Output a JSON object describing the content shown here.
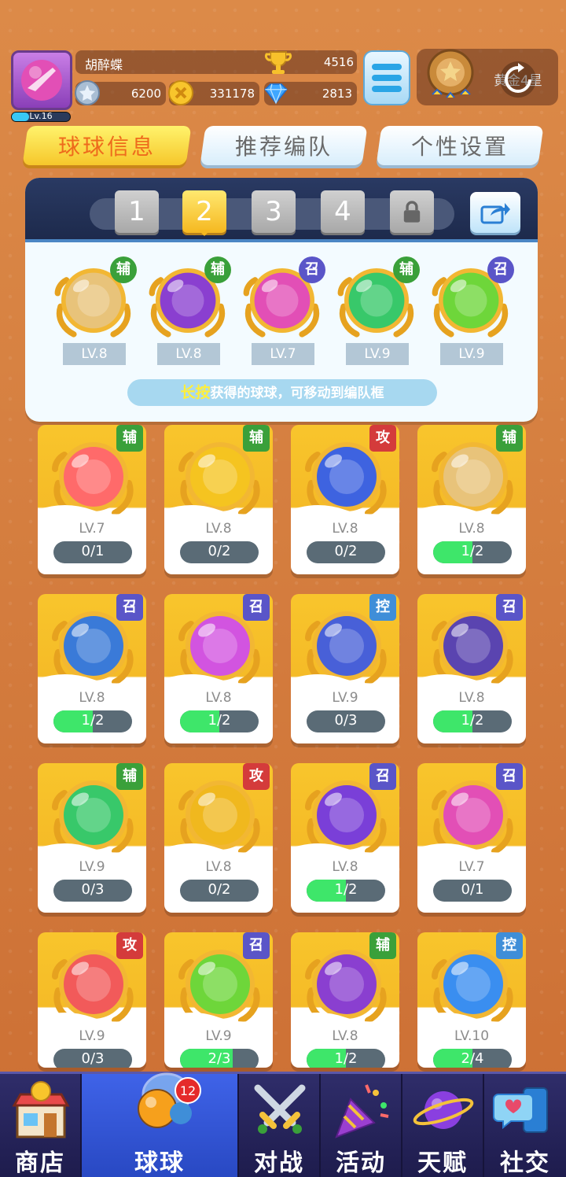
{
  "player": {
    "name": "胡醉蝶",
    "level": "Lv.16",
    "trophies": "4516",
    "silver": "6200",
    "gold": "331178",
    "gems": "2813",
    "rank": "黄金4星"
  },
  "tabs": [
    "球球信息",
    "推荐编队",
    "个性设置"
  ],
  "team": {
    "slots": [
      "1",
      "2",
      "3",
      "4"
    ],
    "active_slot": "2",
    "hint_key": "长按",
    "hint_rest": "获得的球球，可移动到编队框",
    "balls": [
      {
        "badge": "辅",
        "level": "LV.8",
        "icon": "people-ball-icon",
        "color": "#e8c37a"
      },
      {
        "badge": "辅",
        "level": "LV.8",
        "icon": "leaf-swirl-ball-icon",
        "color": "#8a3fd0"
      },
      {
        "badge": "召",
        "level": "LV.7",
        "icon": "knife-ball-icon",
        "color": "#e24fb6"
      },
      {
        "badge": "辅",
        "level": "LV.9",
        "icon": "star-arrow-ball-icon",
        "color": "#38c86a"
      },
      {
        "badge": "召",
        "level": "LV.9",
        "icon": "star-circle-ball-icon",
        "color": "#6ed63a"
      }
    ]
  },
  "cards": [
    {
      "badge": "辅",
      "type": "fu",
      "level": "LV.7",
      "progress": "0/1",
      "fill": 0,
      "icon": "gift-ball-icon",
      "color": "#ff6a6a"
    },
    {
      "badge": "辅",
      "type": "fu",
      "level": "LV.8",
      "progress": "0/2",
      "fill": 0,
      "icon": "piggy-bank-ball-icon",
      "color": "#f5c420"
    },
    {
      "badge": "攻",
      "type": "gong",
      "level": "LV.8",
      "progress": "0/2",
      "fill": 0,
      "icon": "vortex-ball-icon",
      "color": "#3e63e0"
    },
    {
      "badge": "辅",
      "type": "fu",
      "level": "LV.8",
      "progress": "1/2",
      "fill": 0.5,
      "icon": "people-ball-icon",
      "color": "#e8c37a"
    },
    {
      "badge": "召",
      "type": "zhao",
      "level": "LV.8",
      "progress": "1/2",
      "fill": 0.5,
      "icon": "whirlwind-ball-icon",
      "color": "#3a7ad8"
    },
    {
      "badge": "召",
      "type": "zhao",
      "level": "LV.8",
      "progress": "1/2",
      "fill": 0.5,
      "icon": "mushroom-cloud-ball-icon",
      "color": "#d254e0"
    },
    {
      "badge": "控",
      "type": "kong",
      "level": "LV.9",
      "progress": "0/3",
      "fill": 0,
      "icon": "clock-ball-icon",
      "color": "#4860d8"
    },
    {
      "badge": "召",
      "type": "zhao",
      "level": "LV.8",
      "progress": "1/2",
      "fill": 0.5,
      "icon": "ghost-ball-icon",
      "color": "#5a44b0"
    },
    {
      "badge": "辅",
      "type": "fu",
      "level": "LV.9",
      "progress": "0/3",
      "fill": 0,
      "icon": "star-arrow-ball-icon",
      "color": "#38c86a"
    },
    {
      "badge": "攻",
      "type": "gong",
      "level": "LV.8",
      "progress": "0/2",
      "fill": 0,
      "icon": "shuriken-ball-icon",
      "color": "#f0b81e"
    },
    {
      "badge": "召",
      "type": "zhao",
      "level": "LV.8",
      "progress": "1/2",
      "fill": 0.5,
      "icon": "planet-ball-icon",
      "color": "#7a3fd8"
    },
    {
      "badge": "召",
      "type": "zhao",
      "level": "LV.7",
      "progress": "0/1",
      "fill": 0,
      "icon": "knife-ball-icon",
      "color": "#e24fb6"
    },
    {
      "badge": "攻",
      "type": "gong",
      "level": "LV.9",
      "progress": "0/3",
      "fill": 0,
      "icon": "fist-ball-icon",
      "color": "#f25a5a"
    },
    {
      "badge": "召",
      "type": "zhao",
      "level": "LV.9",
      "progress": "2/3",
      "fill": 0.667,
      "icon": "star-circle-ball-icon",
      "color": "#6ed63a"
    },
    {
      "badge": "辅",
      "type": "fu",
      "level": "LV.8",
      "progress": "1/2",
      "fill": 0.5,
      "icon": "leaf-swirl-ball-icon",
      "color": "#8a3fd0"
    },
    {
      "badge": "控",
      "type": "kong",
      "level": "LV.10",
      "progress": "2/4",
      "fill": 0.5,
      "icon": "snowflake-ball-icon",
      "color": "#3a8ef0"
    }
  ],
  "nav": [
    {
      "label": "商店",
      "icon": "shop-icon",
      "name": "nav-shop"
    },
    {
      "label": "球球",
      "icon": "balls-icon",
      "name": "nav-balls",
      "badge": "12"
    },
    {
      "label": "对战",
      "icon": "crossed-swords-icon",
      "name": "nav-battle"
    },
    {
      "label": "活动",
      "icon": "party-popper-icon",
      "name": "nav-events"
    },
    {
      "label": "天赋",
      "icon": "planet-icon",
      "name": "nav-talent"
    },
    {
      "label": "社交",
      "icon": "chat-phone-icon",
      "name": "nav-social"
    }
  ]
}
